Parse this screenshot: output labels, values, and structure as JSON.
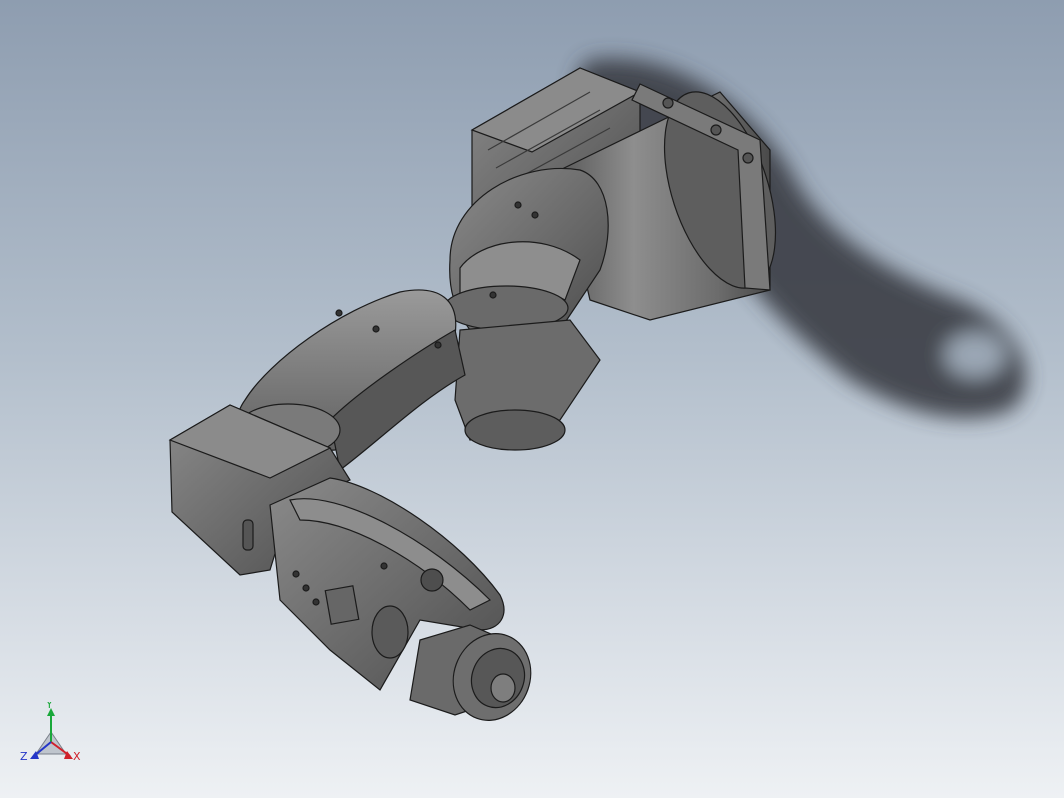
{
  "viewport": {
    "background_top": "#8e9db0",
    "background_bottom": "#eef1f4",
    "model": {
      "name": "robot-arm-model",
      "shade": "#6e6e6e",
      "edge_color": "#1b1b1b",
      "highlight": "#a9a9a9",
      "shadow_color": "#2c2f35"
    }
  },
  "triad": {
    "x_label": "X",
    "y_label": "Y",
    "z_label": "Z",
    "x_color": "#d0202a",
    "y_color": "#19a83a",
    "z_color": "#2436c8"
  }
}
